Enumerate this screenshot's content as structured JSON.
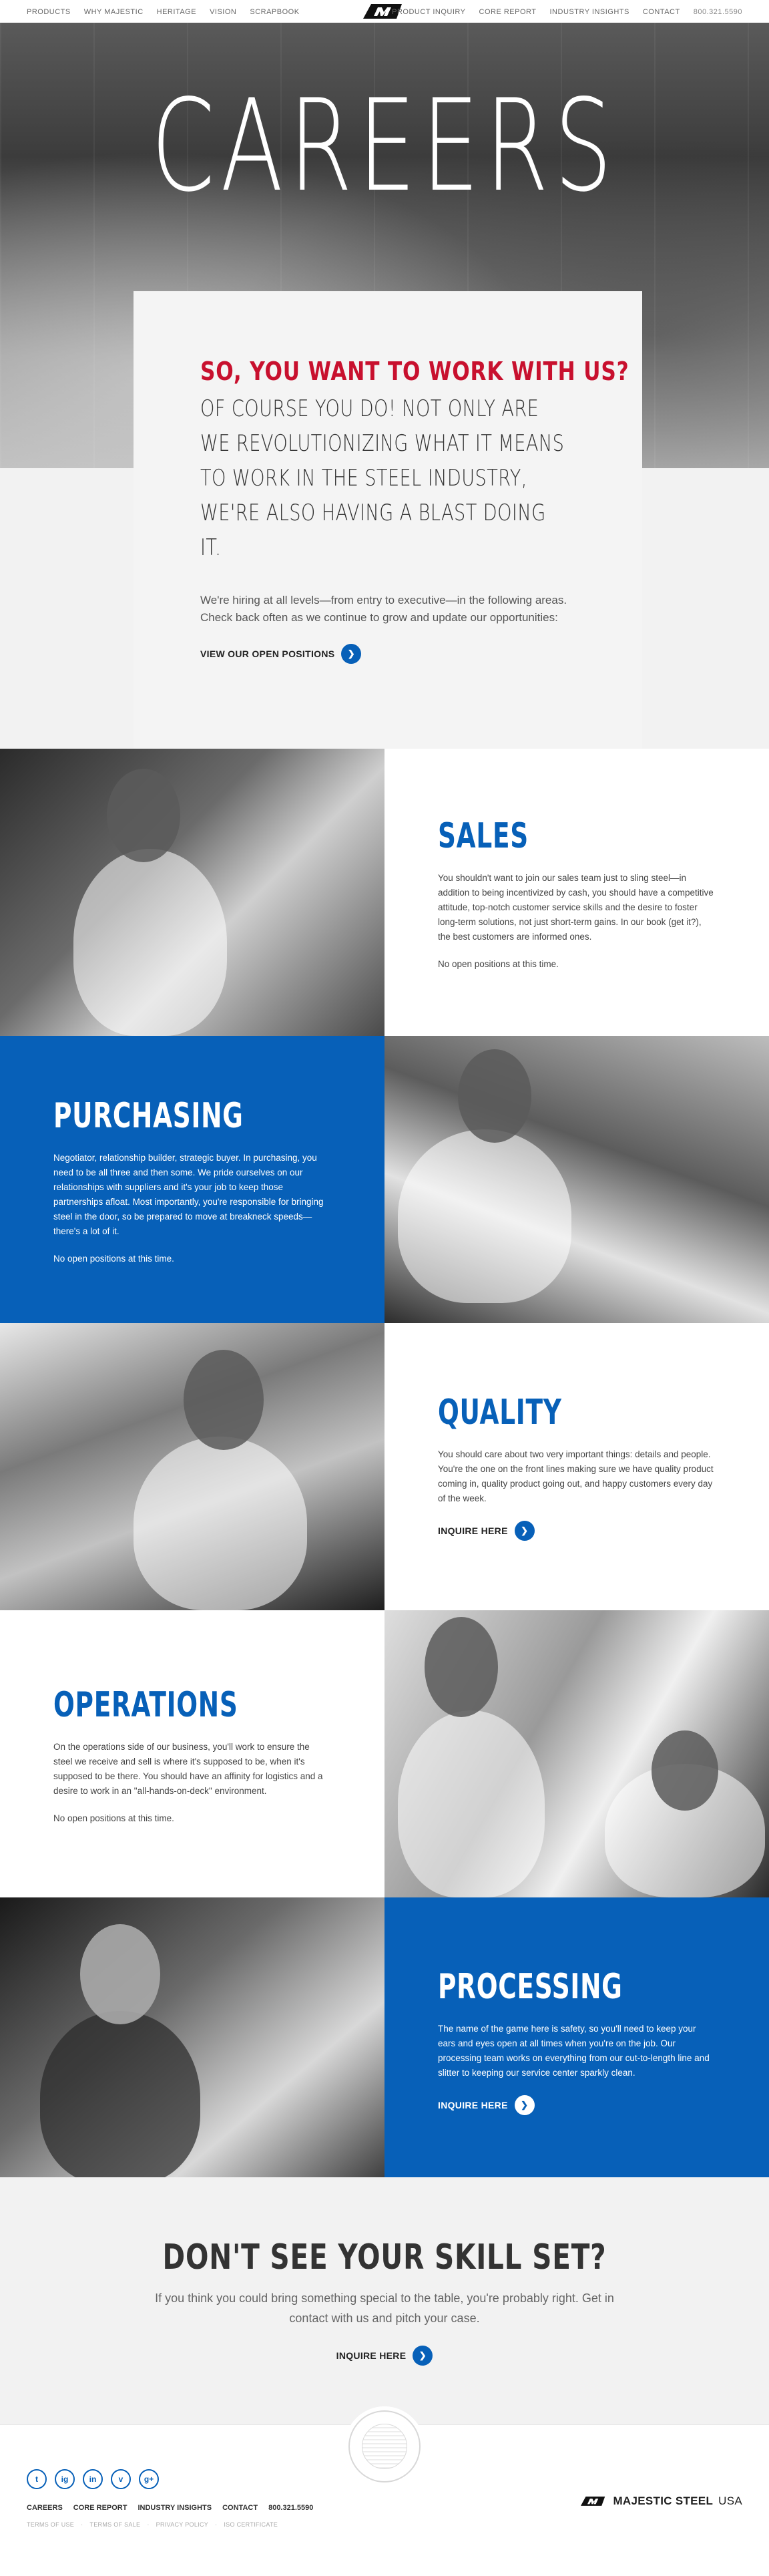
{
  "nav": {
    "left": [
      "PRODUCTS",
      "WHY MAJESTIC",
      "HERITAGE",
      "VISION",
      "SCRAPBOOK"
    ],
    "right": [
      "PRODUCT INQUIRY",
      "CORE REPORT",
      "INDUSTRY INSIGHTS",
      "CONTACT"
    ],
    "phone": "800.321.5590"
  },
  "hero": {
    "title": "CAREERS"
  },
  "intro": {
    "headline": "SO, YOU WANT TO WORK WITH US?",
    "lead": "OF COURSE YOU DO!  NOT ONLY ARE WE REVOLUTIONIZING WHAT IT MEANS TO WORK IN THE STEEL INDUSTRY, WE'RE ALSO HAVING A BLAST DOING IT.",
    "body": "We're hiring at all levels—from entry to executive—in the following areas. Check back often as we continue to grow and update our opportunities:",
    "cta": "VIEW OUR OPEN POSITIONS"
  },
  "jobs": [
    {
      "title": "SALES",
      "text": "You shouldn't want to join our sales team just to sling steel—in addition to being incentivized by cash, you should have a competitive attitude, top-notch customer service skills and the desire to foster long-term solutions, not just short-term gains. In our book (get it?), the best customers are informed ones.",
      "note": "No open positions at this time."
    },
    {
      "title": "PURCHASING",
      "text": "Negotiator, relationship builder, strategic buyer. In purchasing, you need to be all three and then some. We pride ourselves on our relationships with suppliers and it's your job to keep those partnerships afloat. Most importantly, you're responsible for bringing steel in the door, so be prepared to move at breakneck speeds—there's a lot of it.",
      "note": "No open positions at this time."
    },
    {
      "title": "QUALITY",
      "text": "You should care about two very important things: details and people. You're the one on the front lines making sure we have quality product coming in, quality product going out, and happy customers every day of the week.",
      "cta": "INQUIRE HERE"
    },
    {
      "title": "OPERATIONS",
      "text": "On the operations side of our business, you'll work to ensure the steel we receive and sell is where it's supposed to be, when it's supposed to be there. You should have an affinity for logistics and a desire to work in an \"all-hands-on-deck\" environment.",
      "note": "No open positions at this time."
    },
    {
      "title": "PROCESSING",
      "text": "The name of the game here is safety, so you'll need to keep your ears and eyes open at all times when you're on the job. Our processing team works on everything from our cut-to-length line and slitter to keeping our service center sparkly clean.",
      "cta": "INQUIRE HERE"
    }
  ],
  "skill": {
    "title": "DON'T SEE YOUR SKILL SET?",
    "text": "If you think you could bring something special to the table, you're probably right. Get in contact with us and pitch your case.",
    "cta": "INQUIRE HERE"
  },
  "footer": {
    "social": [
      "t",
      "ig",
      "in",
      "v",
      "g+"
    ],
    "nav": [
      "CAREERS",
      "CORE REPORT",
      "INDUSTRY INSIGHTS",
      "CONTACT",
      "800.321.5590"
    ],
    "legal": [
      "TERMS OF USE",
      "TERMS OF SALE",
      "PRIVACY POLICY",
      "ISO CERTIFICATE"
    ],
    "brand": "MAJESTIC STEEL",
    "brand_suffix": "USA"
  },
  "colors": {
    "blue": "#0760b8",
    "red": "#c8102e"
  }
}
